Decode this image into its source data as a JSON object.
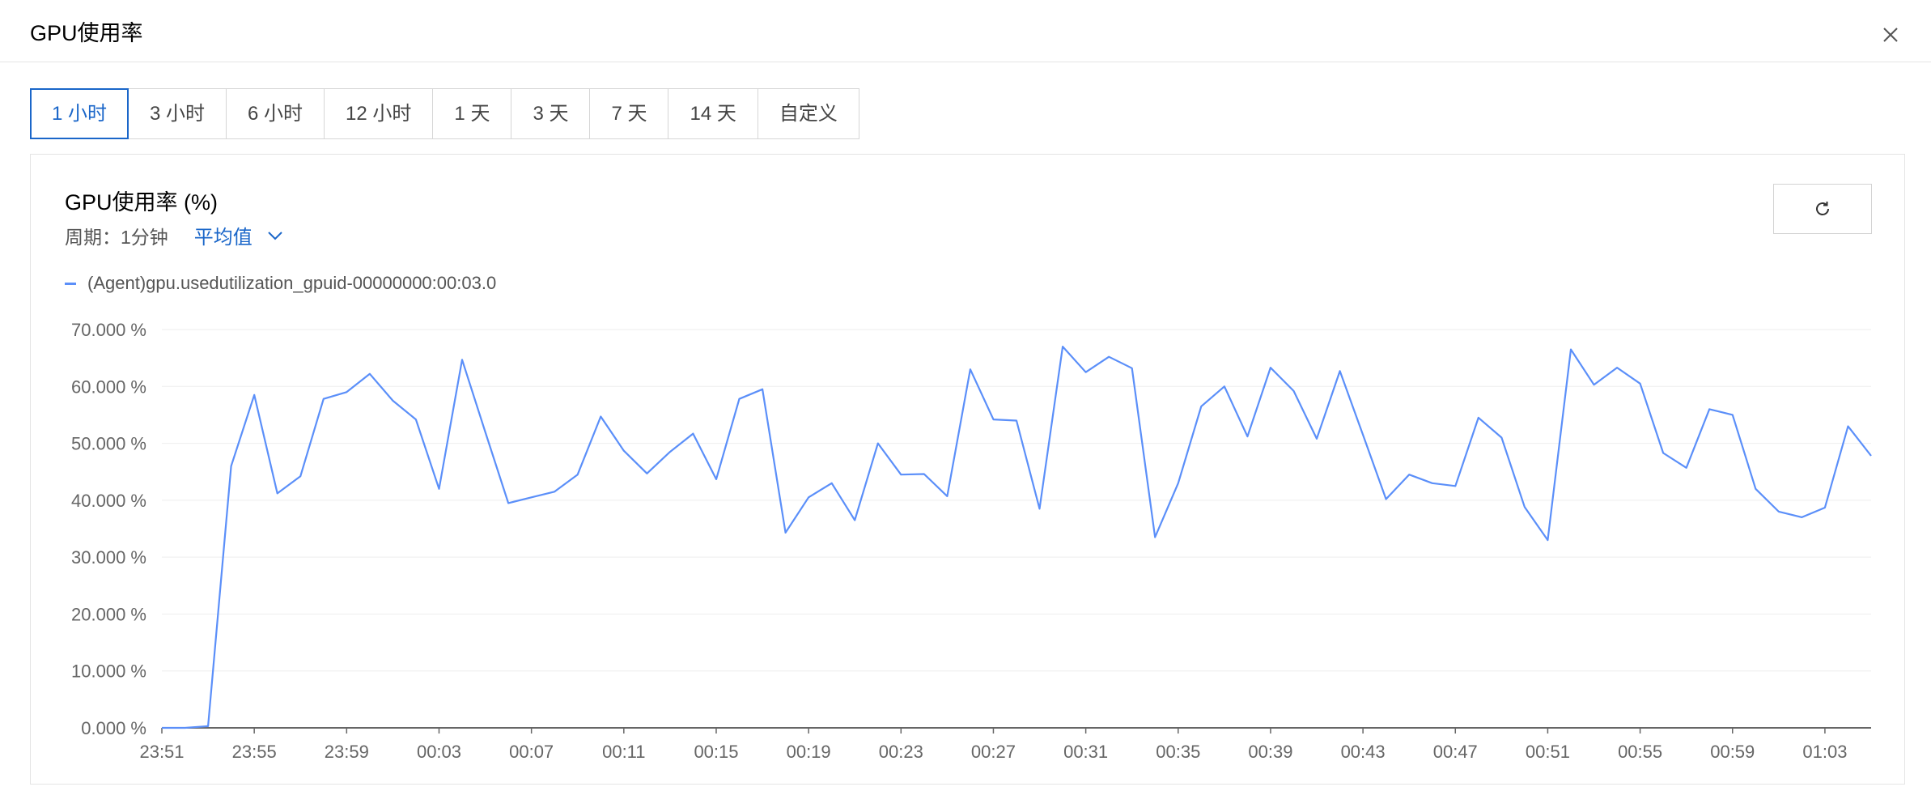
{
  "dialog": {
    "title": "GPU使用率",
    "close_icon": "close-icon"
  },
  "range_tabs": [
    {
      "label": "1 小时",
      "active": true
    },
    {
      "label": "3 小时",
      "active": false
    },
    {
      "label": "6 小时",
      "active": false
    },
    {
      "label": "12 小时",
      "active": false
    },
    {
      "label": "1 天",
      "active": false
    },
    {
      "label": "3 天",
      "active": false
    },
    {
      "label": "7 天",
      "active": false
    },
    {
      "label": "14 天",
      "active": false
    },
    {
      "label": "自定义",
      "active": false
    }
  ],
  "panel": {
    "title": "GPU使用率 (%)",
    "period_label": "周期：1分钟",
    "aggregation": "平均值",
    "refresh_icon": "refresh-icon"
  },
  "colors": {
    "accent": "#1a66c9",
    "series": "#5b8ff9",
    "grid": "#eeeeee"
  },
  "chart_data": {
    "type": "line",
    "title": "GPU使用率 (%)",
    "ylim": [
      0,
      70
    ],
    "y_ticks": [
      "0.000 %",
      "10.000 %",
      "20.000 %",
      "30.000 %",
      "40.000 %",
      "50.000 %",
      "60.000 %",
      "70.000 %"
    ],
    "x_ticks": [
      "23:51",
      "23:55",
      "23:59",
      "00:03",
      "00:07",
      "00:11",
      "00:15",
      "00:19",
      "00:23",
      "00:27",
      "00:31",
      "00:35",
      "00:39",
      "00:43",
      "00:47",
      "00:51",
      "00:55",
      "00:59",
      "01:03"
    ],
    "x": [
      "23:51",
      "23:52",
      "23:53",
      "23:54",
      "23:55",
      "23:56",
      "23:57",
      "23:58",
      "23:59",
      "00:00",
      "00:01",
      "00:02",
      "00:03",
      "00:04",
      "00:05",
      "00:06",
      "00:07",
      "00:08",
      "00:09",
      "00:10",
      "00:11",
      "00:12",
      "00:13",
      "00:14",
      "00:15",
      "00:16",
      "00:17",
      "00:18",
      "00:19",
      "00:20",
      "00:21",
      "00:22",
      "00:23",
      "00:24",
      "00:25",
      "00:26",
      "00:27",
      "00:28",
      "00:29",
      "00:30",
      "00:31",
      "00:32",
      "00:33",
      "00:34",
      "00:35",
      "00:36",
      "00:37",
      "00:38",
      "00:39",
      "00:40",
      "00:41",
      "00:42",
      "00:43",
      "00:44",
      "00:45",
      "00:46",
      "00:47",
      "00:48",
      "00:49",
      "00:50",
      "00:51",
      "00:52",
      "00:53",
      "00:54",
      "00:55",
      "00:56",
      "00:57",
      "00:58",
      "00:59",
      "01:00",
      "01:01",
      "01:02",
      "01:03",
      "01:04",
      "01:05"
    ],
    "series": [
      {
        "name": "(Agent)gpu.usedutilization_gpuid-00000000:00:03.0",
        "values": [
          0.0,
          0.0,
          0.3,
          46.0,
          58.5,
          41.2,
          44.2,
          57.8,
          59.0,
          62.2,
          57.5,
          54.2,
          42.0,
          64.7,
          52.0,
          39.5,
          40.5,
          41.5,
          44.5,
          54.7,
          48.7,
          44.7,
          48.5,
          51.7,
          43.7,
          57.8,
          59.5,
          34.3,
          40.5,
          43.0,
          36.5,
          50.0,
          44.5,
          44.6,
          40.7,
          63.0,
          54.2,
          54.0,
          38.5,
          67.0,
          62.5,
          65.2,
          63.2,
          33.5,
          43.0,
          56.5,
          60.0,
          51.2,
          63.3,
          59.2,
          50.8,
          62.7,
          51.5,
          40.2,
          44.5,
          43.0,
          42.5,
          54.5,
          51.0,
          38.8,
          33.0,
          66.5,
          60.3,
          63.3,
          60.5,
          48.3,
          45.7,
          56.0,
          55.0,
          42.0,
          38.0,
          37.0,
          38.7,
          53.0,
          47.8
        ]
      }
    ],
    "grid": true,
    "legend_position": "top-left"
  }
}
